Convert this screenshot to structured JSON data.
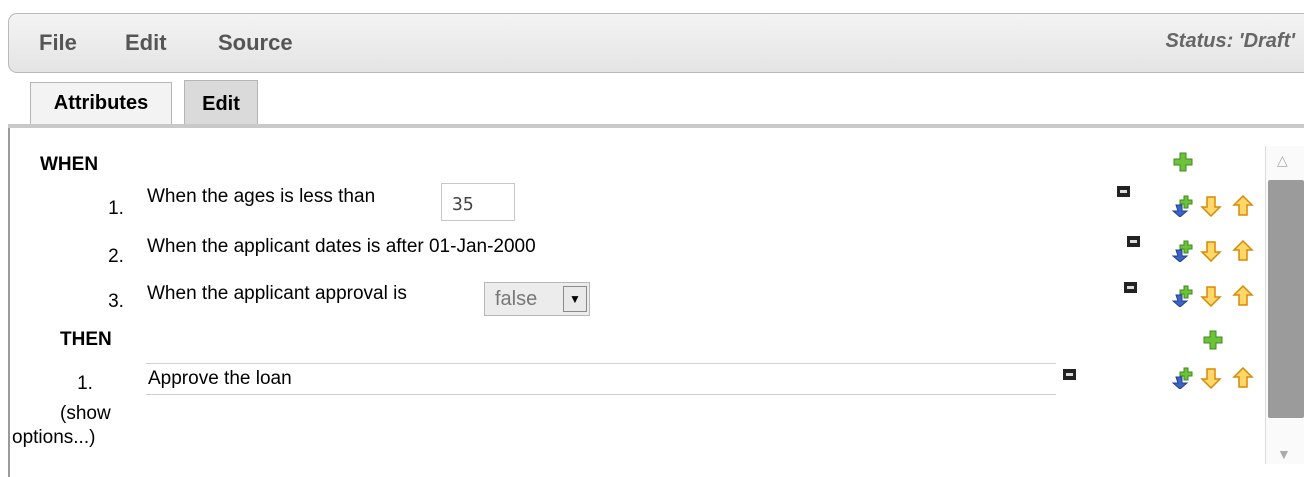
{
  "menubar": {
    "items": [
      "File",
      "Edit",
      "Source"
    ],
    "status": "Status: 'Draft'"
  },
  "tabs": [
    "Attributes",
    "Edit"
  ],
  "rule": {
    "when_label": "WHEN",
    "then_label": "THEN",
    "conditions": [
      {
        "number": "1.",
        "text": "When the ages is less than",
        "input_value": "35"
      },
      {
        "number": "2.",
        "text": "When the applicant dates is after 01-Jan-2000"
      },
      {
        "number": "3.",
        "text": "When the applicant approval is",
        "select_value": "false"
      }
    ],
    "actions": [
      {
        "number": "1.",
        "text": "Approve the loan"
      }
    ],
    "show_options_line1": "(show",
    "show_options_line2": "options...)"
  },
  "icons": {
    "add": "add-plus-icon",
    "insert": "insert-row-icon",
    "move_down": "arrow-down-icon",
    "move_up": "arrow-up-icon",
    "remove": "remove-icon"
  },
  "colors": {
    "plus_green": "#5cb82e",
    "arrow_orange": "#f2a21a",
    "insert_blue": "#3c63c8",
    "scrollbar": "#9b9b9b"
  }
}
